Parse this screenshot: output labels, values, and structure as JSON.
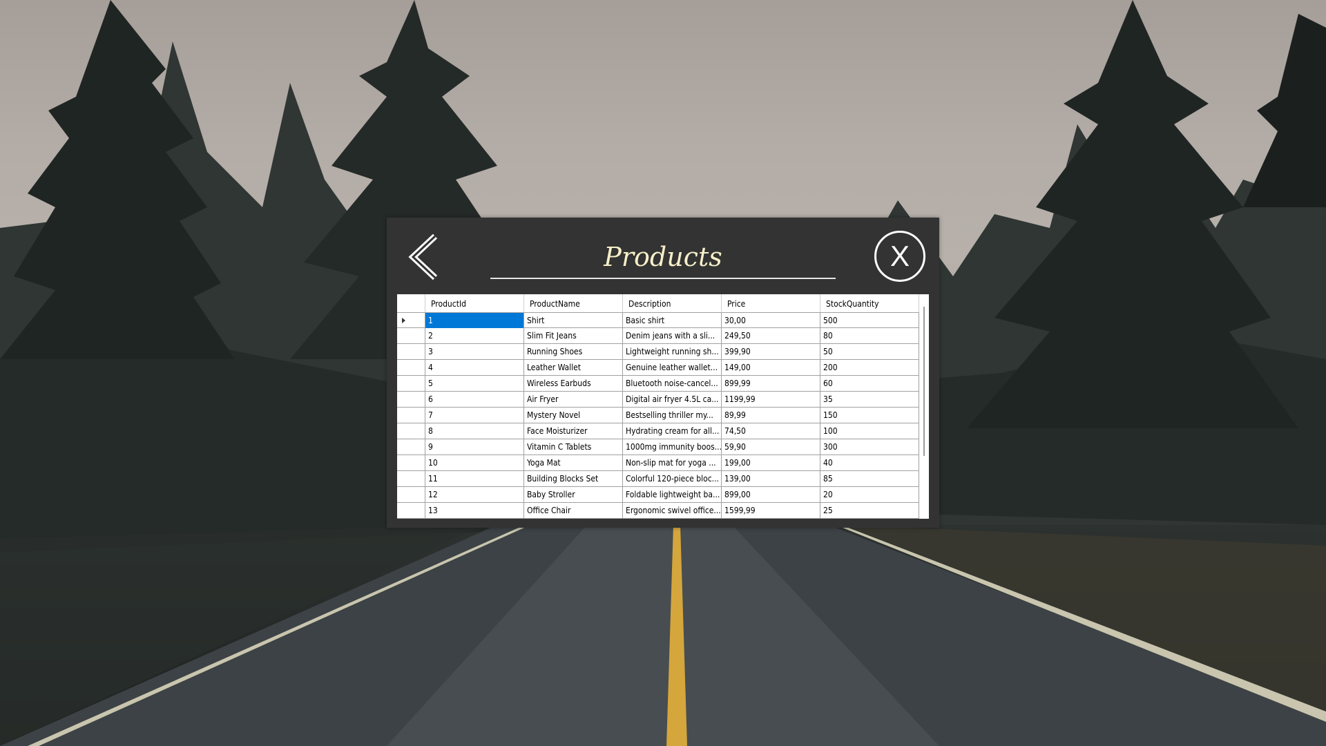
{
  "window": {
    "title": "Products",
    "back_icon": "chevron-left-icon",
    "close_label": "X"
  },
  "grid": {
    "columns": [
      "ProductId",
      "ProductName",
      "Description",
      "Price",
      "StockQuantity"
    ],
    "selected_row": 0,
    "rows": [
      [
        "1",
        "Shirt",
        "Basic shirt",
        "30,00",
        "500"
      ],
      [
        "2",
        "Slim Fit Jeans",
        "Denim jeans with a sli...",
        "249,50",
        "80"
      ],
      [
        "3",
        "Running Shoes",
        "Lightweight running sh...",
        "399,90",
        "50"
      ],
      [
        "4",
        "Leather Wallet",
        "Genuine leather wallet...",
        "149,00",
        "200"
      ],
      [
        "5",
        "Wireless Earbuds",
        "Bluetooth noise-cancel...",
        "899,99",
        "60"
      ],
      [
        "6",
        "Air Fryer",
        "Digital air fryer 4.5L ca...",
        "1199,99",
        "35"
      ],
      [
        "7",
        "Mystery Novel",
        "Bestselling thriller my...",
        "89,99",
        "150"
      ],
      [
        "8",
        "Face Moisturizer",
        "Hydrating cream for all...",
        "74,50",
        "100"
      ],
      [
        "9",
        "Vitamin C Tablets",
        "1000mg immunity boos...",
        "59,90",
        "300"
      ],
      [
        "10",
        "Yoga Mat",
        "Non-slip mat for yoga ...",
        "199,00",
        "40"
      ],
      [
        "11",
        "Building Blocks Set",
        "Colorful 120-piece bloc...",
        "139,00",
        "85"
      ],
      [
        "12",
        "Baby Stroller",
        "Foldable lightweight ba...",
        "899,00",
        "20"
      ],
      [
        "13",
        "Office Chair",
        "Ergonomic swivel office...",
        "1599,99",
        "25"
      ]
    ]
  }
}
